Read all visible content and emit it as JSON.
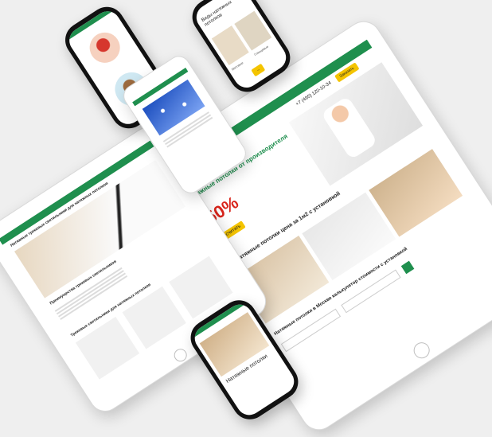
{
  "tablet_right": {
    "phone_number": "+7 (495) 120-10-34",
    "hero_title": "Натяжные потолки от производителя",
    "discount": "-50%",
    "cta": "Рассчитать",
    "section_title": "Натяжные потолки цена за 1м2 с установкой",
    "calculator_title": "Натяжные потолки в Москве калькулятор стоимости с установкой"
  },
  "tablet_left": {
    "title": "Натяжные трековые светильники для натяжных потолков",
    "subtitle": "Преимущества трековых светильников",
    "section": "Трековые светильники для натяжных потолков"
  },
  "phone_top": {
    "title": "Виды натяжных потолков",
    "label1": "Матовые",
    "label2": "Глянцевые"
  },
  "phone_bottom": {
    "title": "Натяжные потолки"
  },
  "colors": {
    "brand_green": "#1f8f4e",
    "accent_yellow": "#f4c400",
    "accent_red": "#d9241b"
  }
}
